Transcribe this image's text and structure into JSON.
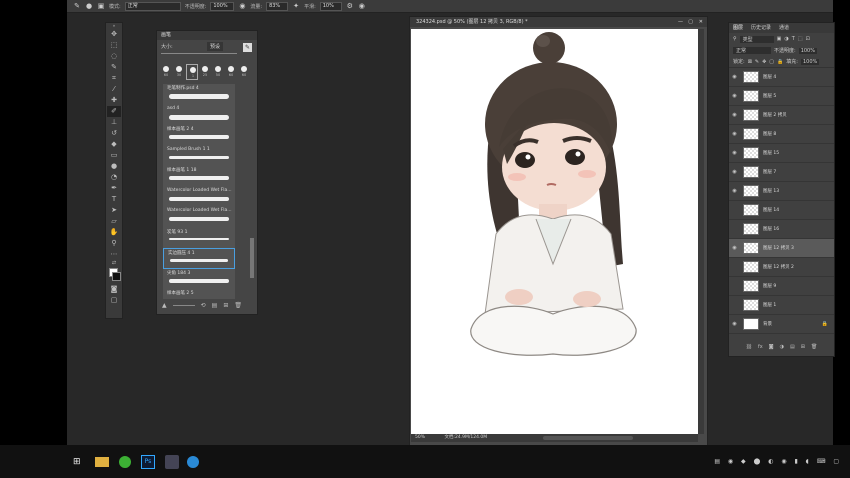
{
  "options_bar": {
    "mode_label": "模式:",
    "mode_value": "正常",
    "opacity_label": "不透明度:",
    "opacity_value": "100%",
    "flow_label": "流量:",
    "flow_value": "83%",
    "smooth_label": "平滑:",
    "smooth_value": "10%"
  },
  "brush_panel": {
    "tab": "画笔",
    "size_label": "大小:",
    "preset_button": "预设",
    "presets": [
      {
        "name": "毛笔制作.psd 4",
        "size": 8
      },
      {
        "name": "asd 4",
        "size": 8
      },
      {
        "name": "样本画笔 2 4",
        "size": 6
      },
      {
        "name": "Sampled Brush 1 1",
        "size": 4
      },
      {
        "name": "样本画笔 1 18",
        "size": 5
      },
      {
        "name": "Watercolor Loaded Wet Fla...",
        "size": 6
      },
      {
        "name": "Watercolor Loaded Wet Fla...",
        "size": 6
      },
      {
        "name": "炭笔 93 1",
        "size": 2
      },
      {
        "name": "实边圆压 4 1",
        "size": 3
      },
      {
        "name": "尖角 184 3",
        "size": 6
      },
      {
        "name": "样本画笔 2 5",
        "size": 7
      }
    ],
    "tip_sizes": [
      "60",
      "30",
      "1",
      "25",
      "50",
      "60",
      "60"
    ]
  },
  "document": {
    "tab_title": "324324.psd @ 50% (图层 12 拷贝 3, RGB/8) *",
    "zoom": "50%",
    "doc_info": "文档:24.9M/124.0M"
  },
  "layers_panel": {
    "tabs": [
      "图层",
      "历史记录",
      "通道"
    ],
    "kind_label": "类型",
    "blend_mode": "正常",
    "opacity_label": "不透明度:",
    "opacity_value": "100%",
    "lock_label": "锁定:",
    "fill_label": "填充:",
    "fill_value": "100%",
    "layers": [
      {
        "name": "图层 4",
        "visible": true
      },
      {
        "name": "图层 5",
        "visible": true
      },
      {
        "name": "图层 2 拷贝",
        "visible": true
      },
      {
        "name": "图层 8",
        "visible": true
      },
      {
        "name": "图层 15",
        "visible": true
      },
      {
        "name": "图层 7",
        "visible": true
      },
      {
        "name": "图层 13",
        "visible": true
      },
      {
        "name": "图层 14",
        "visible": false
      },
      {
        "name": "图层 16",
        "visible": false
      },
      {
        "name": "图层 12 拷贝 3",
        "visible": true,
        "selected": true
      },
      {
        "name": "图层 12 拷贝 2",
        "visible": false
      },
      {
        "name": "图层 9",
        "visible": false
      },
      {
        "name": "图层 1",
        "visible": false
      },
      {
        "name": "背景",
        "visible": true,
        "locked": true
      }
    ]
  },
  "taskbar": {
    "apps": [
      "start",
      "file-explorer",
      "wechat",
      "photoshop",
      "recorder",
      "browser"
    ]
  },
  "colors": {
    "app_bg": "#282828",
    "panel_bg": "#404040",
    "selected_layer": "#5a5a5a",
    "selected_brush_border": "#4a9fe0"
  }
}
